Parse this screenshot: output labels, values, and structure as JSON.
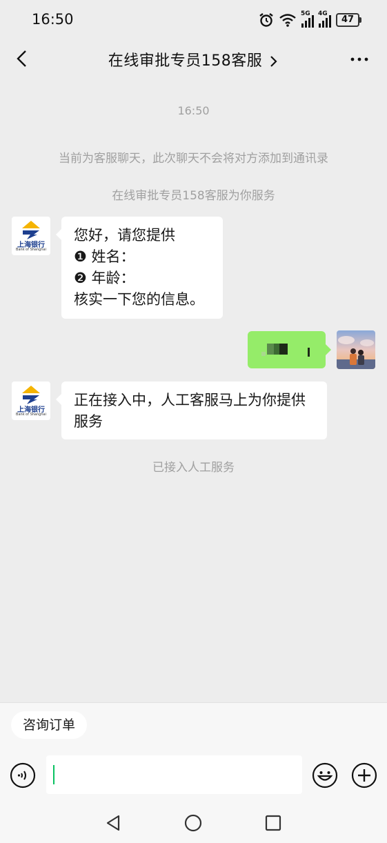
{
  "status_bar": {
    "time": "16:50",
    "net_5g": "5G",
    "net_4g": "4G",
    "battery": "47"
  },
  "header": {
    "title": "在线审批专员158客服"
  },
  "chat": {
    "timestamp": "16:50",
    "notice_1": "当前为客服聊天，此次聊天不会将对方添加到通讯录",
    "notice_2": "在线审批专员158客服为你服务",
    "bank_name_cn": "上海银行",
    "bank_name_en": "Bank of Shanghai",
    "msg1_line1": "您好，请您提供",
    "msg1_line2": "❶ 姓名：",
    "msg1_line3": "❷ 年龄：",
    "msg1_line4": "核实一下您的信息。",
    "msg2": "正在接入中，人工客服马上为你提供服务",
    "notice_3": "已接入人工服务"
  },
  "quick_reply": {
    "chip": "咨询订单"
  },
  "colors": {
    "background": "#ededed",
    "bubble_in": "#ffffff",
    "bubble_out": "#95ec69",
    "system_text": "#a0a0a0",
    "accent": "#07c160",
    "bank_blue": "#1d3f8f",
    "bank_yellow": "#f5b400"
  }
}
